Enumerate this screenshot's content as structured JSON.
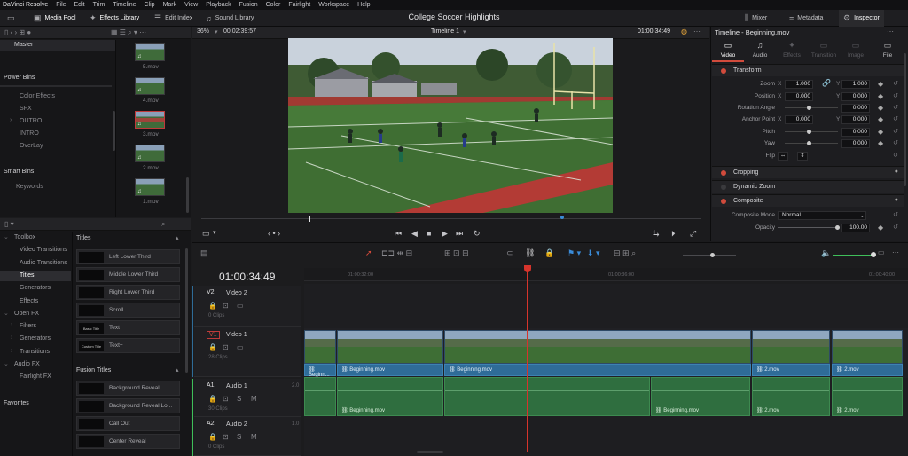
{
  "menu": [
    "DaVinci Resolve",
    "File",
    "Edit",
    "Trim",
    "Timeline",
    "Clip",
    "Mark",
    "View",
    "Playback",
    "Fusion",
    "Color",
    "Fairlight",
    "Workspace",
    "Help"
  ],
  "toolbar": {
    "media_pool": "Media Pool",
    "effects_library": "Effects Library",
    "edit_index": "Edit Index",
    "sound_library": "Sound Library",
    "project_title": "College Soccer Highlights",
    "mixer": "Mixer",
    "metadata": "Metadata",
    "inspector": "Inspector"
  },
  "viewer": {
    "zoom": "36%",
    "timecode_left": "00:02:39:57",
    "timeline_name": "Timeline 1",
    "timecode_right": "01:00:34:49"
  },
  "media_pool": {
    "bin_master": "Master",
    "power_bins": "Power Bins",
    "power_bin_items": [
      "Color Effects",
      "SFX",
      "OUTRO",
      "INTRO",
      "OverLay"
    ],
    "smart_bins": "Smart Bins",
    "smart_bin_items": [
      "Keywords"
    ],
    "clips": [
      "5.mov",
      "4.mov",
      "3.mov",
      "2.mov",
      "1.mov"
    ]
  },
  "effects": {
    "tree": [
      {
        "label": "Toolbox",
        "indent": 0
      },
      {
        "label": "Video Transitions",
        "indent": 1
      },
      {
        "label": "Audio Transitions",
        "indent": 1
      },
      {
        "label": "Titles",
        "indent": 1
      },
      {
        "label": "Generators",
        "indent": 1
      },
      {
        "label": "Effects",
        "indent": 1
      },
      {
        "label": "Open FX",
        "indent": 0
      },
      {
        "label": "Filters",
        "indent": 1
      },
      {
        "label": "Generators",
        "indent": 1
      },
      {
        "label": "Transitions",
        "indent": 1
      },
      {
        "label": "Audio FX",
        "indent": 0
      },
      {
        "label": "Fairlight FX",
        "indent": 1
      }
    ],
    "favorites": "Favorites",
    "titles_header": "Titles",
    "titles": [
      "Left Lower Third",
      "Middle Lower Third",
      "Right Lower Third",
      "Scroll",
      "Text",
      "Text+"
    ],
    "title_previews": [
      "",
      "",
      "",
      "",
      "Basic Title",
      "Custom Title"
    ],
    "fusion_header": "Fusion Titles",
    "fusion_titles": [
      "Background Reveal",
      "Background Reveal Lo...",
      "Call Out",
      "Center Reveal"
    ]
  },
  "timeline": {
    "timecode": "01:00:34:49",
    "ruler": [
      "01:00:32:00",
      "01:00:36:00",
      "01:00:40:00"
    ],
    "tracks": [
      {
        "id": "V2",
        "name": "Video 2",
        "clips": "0 Clips"
      },
      {
        "id": "V1",
        "name": "Video 1",
        "clips": "28 Clips"
      },
      {
        "id": "A1",
        "name": "Audio 1",
        "level": "2.0",
        "clips": "30 Clips"
      },
      {
        "id": "A2",
        "name": "Audio 2",
        "level": "1.0",
        "clips": "0 Clips"
      }
    ],
    "clip_name": "Beginning.mov",
    "clip_name_short": "Beginn...",
    "clip_name_2": "2.mov"
  },
  "inspector": {
    "title": "Timeline - Beginning.mov",
    "tabs": [
      "Video",
      "Audio",
      "Effects",
      "Transition",
      "Image",
      "File"
    ],
    "transform": "Transform",
    "zoom_label": "Zoom",
    "zoom_x": "1.000",
    "zoom_y": "1.000",
    "position_label": "Position",
    "position_x": "0.000",
    "position_y": "0.000",
    "rotation_label": "Rotation Angle",
    "rotation": "0.000",
    "anchor_label": "Anchor Point",
    "anchor_x": "0.000",
    "anchor_y": "0.000",
    "pitch_label": "Pitch",
    "pitch": "0.000",
    "yaw_label": "Yaw",
    "yaw": "0.000",
    "flip_label": "Flip",
    "x": "X",
    "y": "Y",
    "cropping": "Cropping",
    "dynamic_zoom": "Dynamic Zoom",
    "composite": "Composite",
    "composite_mode_label": "Composite Mode",
    "composite_mode": "Normal",
    "opacity_label": "Opacity",
    "opacity": "100.00"
  },
  "colors": {
    "accent_red": "#d14b3c",
    "playhead": "#d6342c",
    "video_clip": "#2f6c98",
    "audio_clip": "#2f6e3f"
  }
}
